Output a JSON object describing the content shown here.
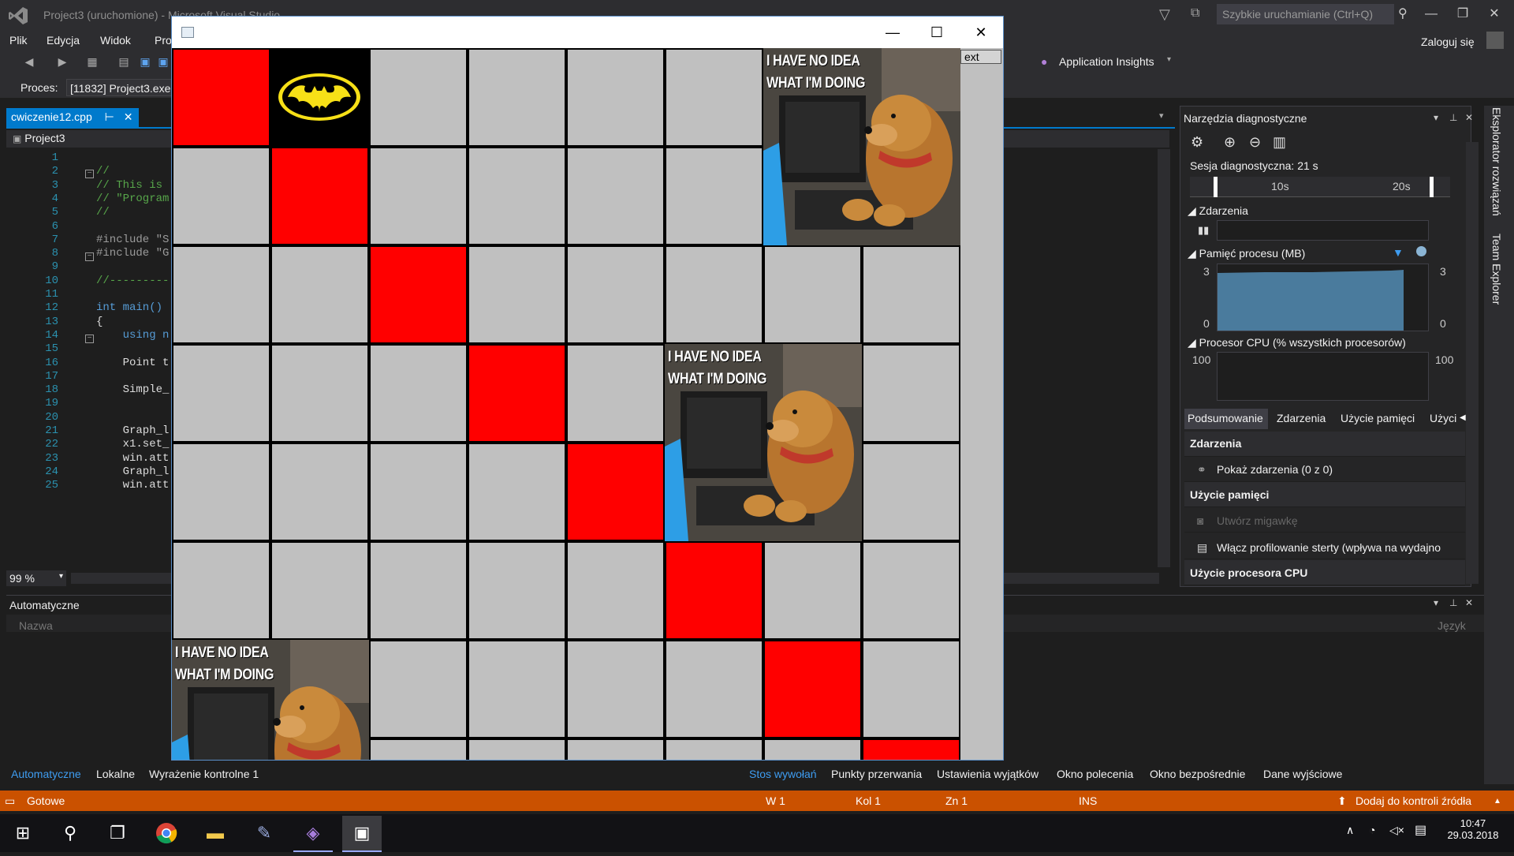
{
  "window": {
    "title": "Project3 (uruchomione) - Microsoft Visual Studio",
    "quick_launch_placeholder": "Szybkie uruchamianie (Ctrl+Q)"
  },
  "menu": {
    "items": [
      "Plik",
      "Edycja",
      "Widok",
      "Pro"
    ],
    "login": "Zaloguj się"
  },
  "toolbar": {
    "process_label": "Proces:",
    "process_value": "[11832] Project3.exe",
    "app_insights": "Application Insights"
  },
  "editor": {
    "tab_name": "cwiczenie12.cpp",
    "pin_icon": "pin-icon",
    "project": "Project3",
    "zoom": "99 %",
    "lines": [
      {
        "n": "1",
        "text": ""
      },
      {
        "n": "2",
        "text": "//"
      },
      {
        "n": "3",
        "text": "// This is"
      },
      {
        "n": "4",
        "text": "// \"Program"
      },
      {
        "n": "5",
        "text": "//"
      },
      {
        "n": "6",
        "text": ""
      },
      {
        "n": "7",
        "text": "#include \"S"
      },
      {
        "n": "8",
        "text": "#include \"G"
      },
      {
        "n": "9",
        "text": ""
      },
      {
        "n": "10",
        "text": "//---------"
      },
      {
        "n": "11",
        "text": ""
      },
      {
        "n": "12",
        "text": "int main()"
      },
      {
        "n": "13",
        "text": "{"
      },
      {
        "n": "14",
        "text": "    using n"
      },
      {
        "n": "15",
        "text": ""
      },
      {
        "n": "16",
        "text": "    Point t"
      },
      {
        "n": "17",
        "text": ""
      },
      {
        "n": "18",
        "text": "    Simple_"
      },
      {
        "n": "19",
        "text": ""
      },
      {
        "n": "20",
        "text": ""
      },
      {
        "n": "21",
        "text": "    Graph_l"
      },
      {
        "n": "22",
        "text": "    x1.set_"
      },
      {
        "n": "23",
        "text": "    win.att"
      },
      {
        "n": "24",
        "text": "    Graph_l"
      },
      {
        "n": "25",
        "text": "    win.att"
      }
    ]
  },
  "autos_panel": {
    "title": "Automatyczne",
    "col_name": "Nazwa",
    "col_lang": "Język",
    "tabs": [
      "Automatyczne",
      "Lokalne",
      "Wyrażenie kontrolne 1"
    ],
    "debug_tabs": [
      "Stos wywołań",
      "Punkty przerwania",
      "Ustawienia wyjątków",
      "Okno polecenia",
      "Okno bezpośrednie",
      "Dane wyjściowe"
    ]
  },
  "status": {
    "ready": "Gotowe",
    "row": "W 1",
    "col": "Kol 1",
    "ch": "Zn 1",
    "mode": "INS",
    "source_control": "Dodaj do kontroli źródła"
  },
  "diagnostics": {
    "title": "Narzędzia diagnostyczne",
    "session": "Sesja diagnostyczna: 21 s",
    "timeline_labels": [
      "10s",
      "20s"
    ],
    "events_title": "Zdarzenia",
    "memory_title": "Pamięć procesu (MB)",
    "memory_max": "3",
    "memory_min": "0",
    "cpu_title": "Procesor CPU (% wszystkich procesorów)",
    "cpu_max": "100",
    "tabs": [
      "Podsumowanie",
      "Zdarzenia",
      "Użycie pamięci",
      "Użyci"
    ],
    "summary_events_header": "Zdarzenia",
    "show_events": "Pokaż zdarzenia (0 z 0)",
    "memory_usage_header": "Użycie pamięci",
    "snapshot": "Utwórz migawkę",
    "heap_profiling": "Włącz profilowanie sterty (wpływa na wydajno",
    "cpu_usage_header": "Użycie procesora CPU",
    "memory_color": "#4a7b9d"
  },
  "side_rail": {
    "items": [
      "Eksplorator rozwiązań",
      "Team Explorer"
    ]
  },
  "app_window": {
    "next_label": "ext",
    "meme_line1": "I HAVE NO IDEA",
    "meme_line2": "WHAT I'M DOING",
    "red_color": "#ff0000",
    "grey_color": "#c0c0c0"
  },
  "taskbar": {
    "time": "10:47",
    "date": "29.03.2018"
  }
}
